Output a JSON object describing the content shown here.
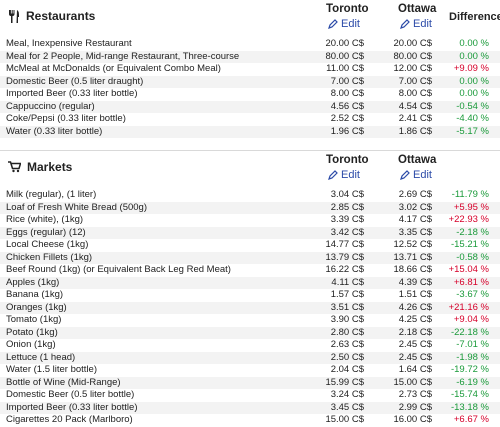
{
  "currency": "C$",
  "colors": {
    "link": "#2c4ba8",
    "increase": "#d6002a",
    "decrease": "#1a9a3a"
  },
  "restaurants": {
    "title": "Restaurants",
    "icon": "utensils-icon",
    "city1": "Toronto",
    "city2": "Ottawa",
    "difference_label": "Difference",
    "edit1": "Edit",
    "edit2": "Edit",
    "rows": [
      {
        "name": "Meal, Inexpensive Restaurant",
        "v1": "20.00 C$",
        "v2": "20.00 C$",
        "diff": "0.00 %",
        "dir": "zero"
      },
      {
        "name": "Meal for 2 People, Mid-range Restaurant, Three-course",
        "v1": "80.00 C$",
        "v2": "80.00 C$",
        "diff": "0.00 %",
        "dir": "zero"
      },
      {
        "name": "McMeal at McDonalds (or Equivalent Combo Meal)",
        "v1": "11.00 C$",
        "v2": "12.00 C$",
        "diff": "+9.09 %",
        "dir": "pos"
      },
      {
        "name": "Domestic Beer (0.5 liter draught)",
        "v1": "7.00 C$",
        "v2": "7.00 C$",
        "diff": "0.00 %",
        "dir": "zero"
      },
      {
        "name": "Imported Beer (0.33 liter bottle)",
        "v1": "8.00 C$",
        "v2": "8.00 C$",
        "diff": "0.00 %",
        "dir": "zero"
      },
      {
        "name": "Cappuccino (regular)",
        "v1": "4.56 C$",
        "v2": "4.54 C$",
        "diff": "-0.54 %",
        "dir": "neg"
      },
      {
        "name": "Coke/Pepsi (0.33 liter bottle)",
        "v1": "2.52 C$",
        "v2": "2.41 C$",
        "diff": "-4.40 %",
        "dir": "neg"
      },
      {
        "name": "Water (0.33 liter bottle)",
        "v1": "1.96 C$",
        "v2": "1.86 C$",
        "diff": "-5.17 %",
        "dir": "neg"
      }
    ]
  },
  "markets": {
    "title": "Markets",
    "icon": "shopping-cart-icon",
    "city1": "Toronto",
    "city2": "Ottawa",
    "edit1": "Edit",
    "edit2": "Edit",
    "rows": [
      {
        "name": "Milk (regular), (1 liter)",
        "v1": "3.04 C$",
        "v2": "2.69 C$",
        "diff": "-11.79 %",
        "dir": "neg"
      },
      {
        "name": "Loaf of Fresh White Bread (500g)",
        "v1": "2.85 C$",
        "v2": "3.02 C$",
        "diff": "+5.95 %",
        "dir": "pos"
      },
      {
        "name": "Rice (white), (1kg)",
        "v1": "3.39 C$",
        "v2": "4.17 C$",
        "diff": "+22.93 %",
        "dir": "pos"
      },
      {
        "name": "Eggs (regular) (12)",
        "v1": "3.42 C$",
        "v2": "3.35 C$",
        "diff": "-2.18 %",
        "dir": "neg"
      },
      {
        "name": "Local Cheese (1kg)",
        "v1": "14.77 C$",
        "v2": "12.52 C$",
        "diff": "-15.21 %",
        "dir": "neg"
      },
      {
        "name": "Chicken Fillets (1kg)",
        "v1": "13.79 C$",
        "v2": "13.71 C$",
        "diff": "-0.58 %",
        "dir": "neg"
      },
      {
        "name": "Beef Round (1kg) (or Equivalent Back Leg Red Meat)",
        "v1": "16.22 C$",
        "v2": "18.66 C$",
        "diff": "+15.04 %",
        "dir": "pos"
      },
      {
        "name": "Apples (1kg)",
        "v1": "4.11 C$",
        "v2": "4.39 C$",
        "diff": "+6.81 %",
        "dir": "pos"
      },
      {
        "name": "Banana (1kg)",
        "v1": "1.57 C$",
        "v2": "1.51 C$",
        "diff": "-3.67 %",
        "dir": "neg"
      },
      {
        "name": "Oranges (1kg)",
        "v1": "3.51 C$",
        "v2": "4.26 C$",
        "diff": "+21.16 %",
        "dir": "pos"
      },
      {
        "name": "Tomato (1kg)",
        "v1": "3.90 C$",
        "v2": "4.25 C$",
        "diff": "+9.04 %",
        "dir": "pos"
      },
      {
        "name": "Potato (1kg)",
        "v1": "2.80 C$",
        "v2": "2.18 C$",
        "diff": "-22.18 %",
        "dir": "neg"
      },
      {
        "name": "Onion (1kg)",
        "v1": "2.63 C$",
        "v2": "2.45 C$",
        "diff": "-7.01 %",
        "dir": "neg"
      },
      {
        "name": "Lettuce (1 head)",
        "v1": "2.50 C$",
        "v2": "2.45 C$",
        "diff": "-1.98 %",
        "dir": "neg"
      },
      {
        "name": "Water (1.5 liter bottle)",
        "v1": "2.04 C$",
        "v2": "1.64 C$",
        "diff": "-19.72 %",
        "dir": "neg"
      },
      {
        "name": "Bottle of Wine (Mid-Range)",
        "v1": "15.99 C$",
        "v2": "15.00 C$",
        "diff": "-6.19 %",
        "dir": "neg"
      },
      {
        "name": "Domestic Beer (0.5 liter bottle)",
        "v1": "3.24 C$",
        "v2": "2.73 C$",
        "diff": "-15.74 %",
        "dir": "neg"
      },
      {
        "name": "Imported Beer (0.33 liter bottle)",
        "v1": "3.45 C$",
        "v2": "2.99 C$",
        "diff": "-13.18 %",
        "dir": "neg"
      },
      {
        "name": "Cigarettes 20 Pack (Marlboro)",
        "v1": "15.00 C$",
        "v2": "16.00 C$",
        "diff": "+6.67 %",
        "dir": "pos"
      }
    ]
  }
}
